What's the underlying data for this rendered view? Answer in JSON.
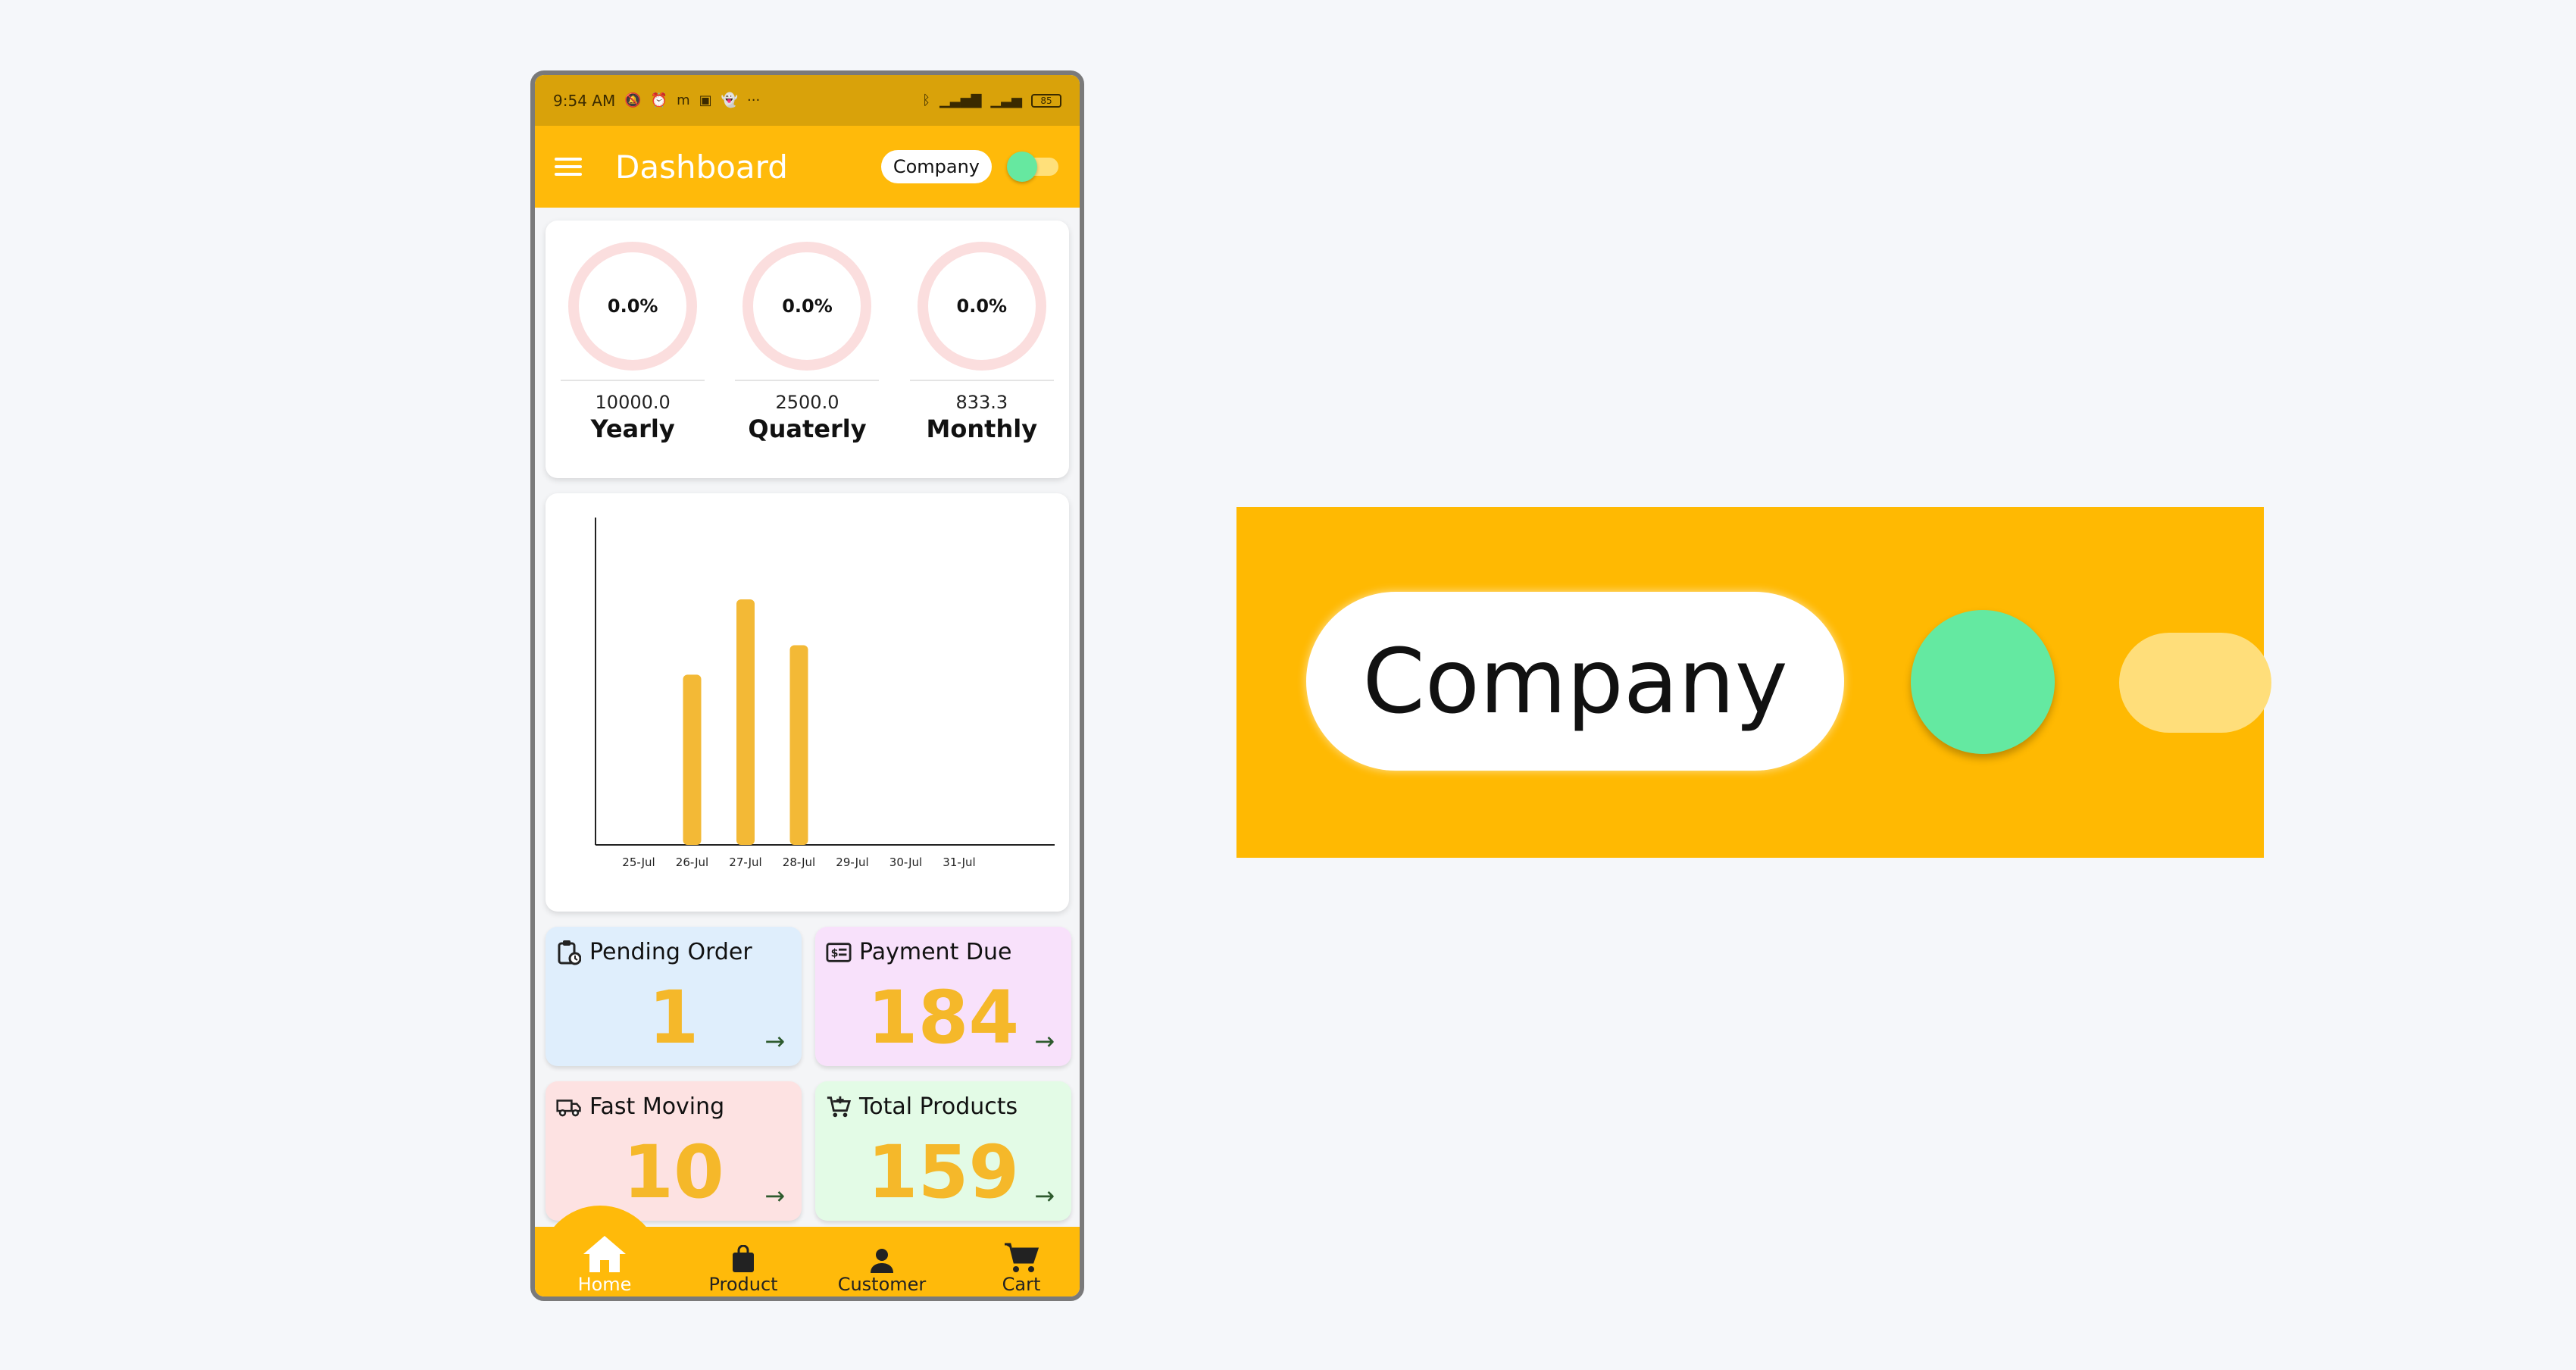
{
  "status_bar": {
    "time": "9:54 AM",
    "icons_left": [
      "mute-icon",
      "alarm-icon",
      "m-icon",
      "app-icon",
      "snapchat-icon",
      "more-dots-icon"
    ],
    "more": "···",
    "battery": "85"
  },
  "app_bar": {
    "title": "Dashboard",
    "company_label": "Company",
    "toggle_on": true
  },
  "stats": [
    {
      "percent": "0.0%",
      "value": "10000.0",
      "label": "Yearly"
    },
    {
      "percent": "0.0%",
      "value": "2500.0",
      "label": "Quaterly"
    },
    {
      "percent": "0.0%",
      "value": "833.3",
      "label": "Monthly"
    }
  ],
  "chart_data": {
    "type": "bar",
    "categories": [
      "25-Jul",
      "26-Jul",
      "27-Jul",
      "28-Jul",
      "29-Jul",
      "30-Jul",
      "31-Jul"
    ],
    "values": [
      0,
      52,
      75,
      61,
      0,
      0,
      0
    ],
    "ylim": [
      0,
      100
    ],
    "grid": false,
    "bar_color": "#f3b936"
  },
  "tiles": [
    {
      "label": "Pending Order",
      "value": "1",
      "icon": "clipboard-clock-icon",
      "bg": "#dfeefc"
    },
    {
      "label": "Payment Due",
      "value": "184",
      "icon": "cash-icon",
      "bg": "#f8e1fb"
    },
    {
      "label": "Fast Moving",
      "value": "10",
      "icon": "truck-icon",
      "bg": "#fde2e2"
    },
    {
      "label": "Total Products",
      "value": "159",
      "icon": "cart-plus-icon",
      "bg": "#e3fbe6"
    }
  ],
  "nav": [
    {
      "label": "Home",
      "icon": "home-icon",
      "active": true
    },
    {
      "label": "Product",
      "icon": "bag-icon",
      "active": false
    },
    {
      "label": "Customer",
      "icon": "person-icon",
      "active": false
    },
    {
      "label": "Cart",
      "icon": "cart-icon",
      "active": false
    }
  ],
  "zoom": {
    "company_label": "Company"
  },
  "colors": {
    "accent": "#ffba0a",
    "status_bar": "#d9a20a",
    "value_text": "#f5b82a",
    "toggle_knob": "#66e8a0"
  }
}
